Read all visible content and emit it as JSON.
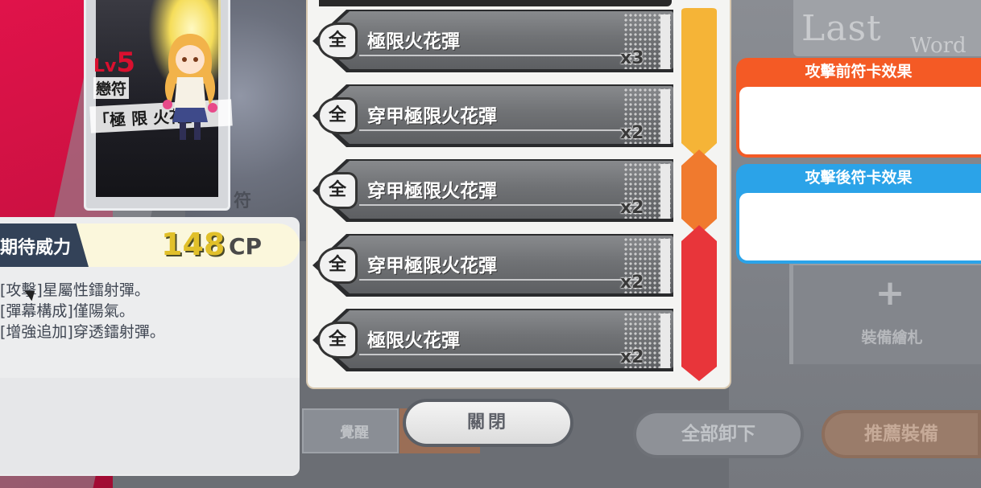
{
  "card": {
    "level_prefix": "Lv",
    "level": "5",
    "spell_type": "戀符",
    "spell_name": "「極 限 火花」",
    "side_char": "符"
  },
  "power": {
    "label": "期待威力",
    "value": "148",
    "unit": "CP",
    "description": [
      "[攻擊]星屬性鐳射彈。",
      "[彈幕構成]僅陽氣。",
      "[增強追加]穿透鐳射彈。"
    ]
  },
  "bullet_list": {
    "items": [
      {
        "badge": "全",
        "name": "極限火花彈",
        "count": "x3"
      },
      {
        "badge": "全",
        "name": "穿甲極限火花彈",
        "count": "x2"
      },
      {
        "badge": "全",
        "name": "穿甲極限火花彈",
        "count": "x2"
      },
      {
        "badge": "全",
        "name": "穿甲極限火花彈",
        "count": "x2"
      },
      {
        "badge": "全",
        "name": "極限火花彈",
        "count": "x2"
      }
    ],
    "chevron_colors": [
      "#f5b437",
      "#f07a2e",
      "#e8353a"
    ]
  },
  "effects": {
    "before_title": "攻擊前符卡效果",
    "before_color": "#f45a25",
    "after_title": "攻擊後符卡效果",
    "after_color": "#2ba3e8"
  },
  "right_panel": {
    "lastword_line1": "Last",
    "lastword_line2": "Word",
    "equip_label": "裝備繪札"
  },
  "tabs": {
    "awaken_label": "覺醒"
  },
  "buttons": {
    "close": "關閉",
    "unequip_all": "全部卸下",
    "recommend": "推薦裝備"
  }
}
